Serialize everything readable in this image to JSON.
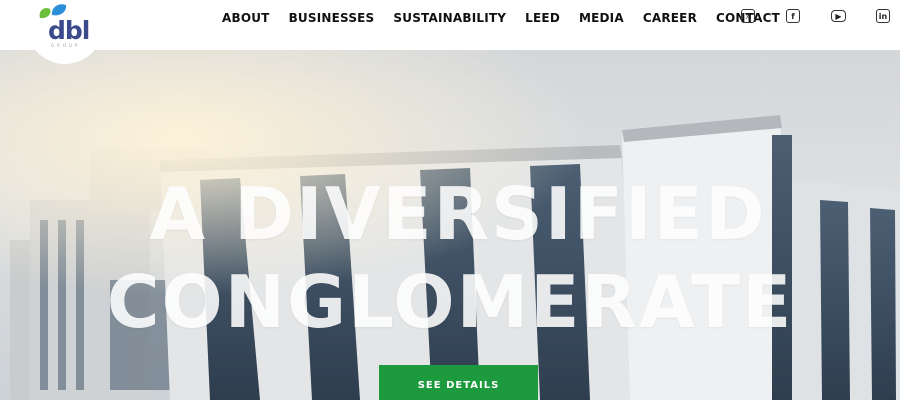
{
  "brand": {
    "logo_text": "dbl",
    "logo_subtext": "GROUP",
    "colors": {
      "accent_green": "#1e9a3e",
      "logo_blue": "#3b4a8a",
      "logo_green": "#6cbf3a",
      "logo_sky": "#2d8fd8"
    }
  },
  "nav": {
    "items": [
      {
        "label": "ABOUT"
      },
      {
        "label": "BUSINESSES"
      },
      {
        "label": "SUSTAINABILITY"
      },
      {
        "label": "LEED"
      },
      {
        "label": "MEDIA"
      },
      {
        "label": "CAREER"
      },
      {
        "label": "CONTACT"
      }
    ]
  },
  "social": {
    "x": {
      "icon": "x-icon",
      "glyph": "𝕏"
    },
    "facebook": {
      "icon": "facebook-icon",
      "glyph": "f"
    },
    "youtube": {
      "icon": "youtube-icon",
      "glyph": "▶"
    },
    "linkedin": {
      "icon": "linkedin-icon",
      "glyph": "in"
    }
  },
  "hero": {
    "title_line1": "A DIVERSIFIED",
    "title_line2": "CONGLOMERATE",
    "cta_label": "SEE DETAILS"
  }
}
